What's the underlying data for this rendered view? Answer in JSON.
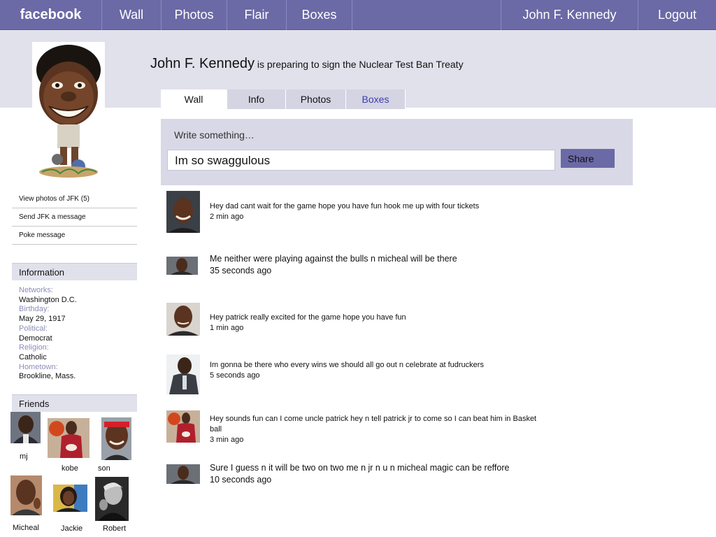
{
  "topnav": {
    "logo": "facebook",
    "items": [
      "Wall",
      "Photos",
      "Flair",
      "Boxes"
    ],
    "user": "John F. Kennedy",
    "logout": "Logout"
  },
  "profile": {
    "name": "John F. Kennedy",
    "status": "is preparing to sign the Nuclear Test Ban Treaty"
  },
  "tabs": [
    "Wall",
    "Info",
    "Photos",
    "Boxes"
  ],
  "composer": {
    "label": "Write something…",
    "value": "Im so swaggulous",
    "share": "Share"
  },
  "links": [
    "View photos of JFK (5)",
    "Send JFK a message",
    "Poke message"
  ],
  "information": {
    "title": "Information",
    "fields": [
      {
        "key": "Networks:",
        "value": "Washington D.C."
      },
      {
        "key": "Birthday:",
        "value": "May 29, 1917"
      },
      {
        "key": "Political:",
        "value": "Democrat"
      },
      {
        "key": "Religion:",
        "value": "Catholic"
      },
      {
        "key": "Hometown:",
        "value": "Brookline, Mass."
      }
    ]
  },
  "friends": {
    "title": "Friends",
    "list": [
      "mj",
      "kobe",
      "son",
      "Micheal",
      "Jackie",
      "Robert"
    ]
  },
  "posts": [
    {
      "text": "Hey dad  cant wait for the game  hope you have fun hook me up with four tickets",
      "time": "2 min ago"
    },
    {
      "text": "Me neither  were playing against the bulls  n micheal  will be  there",
      "time": "35 seconds ago"
    },
    {
      "text": "Hey patrick really excited for  the game hope you have  fun",
      "time": "1 min ago"
    },
    {
      "text": "Im gonna be there  who every wins we should all  go  out n  celebrate at  fudruckers",
      "time": "5 seconds ago"
    },
    {
      "text": "Hey sounds fun can I come uncle patrick  hey  n  tell  patrick jr  to come  so I can beat him in Basket ball",
      "time": "3 min ago"
    },
    {
      "text": "Sure I guess n it will  be two on two me n jr n u n micheal magic can be reffore",
      "time": "10 seconds ago"
    }
  ],
  "colors": {
    "nav": "#6b69a6",
    "band": "#e1e1ec",
    "composer": "#d8d8e6",
    "link_blue": "#3b3bb3",
    "label_muted": "#8d8dbb"
  }
}
